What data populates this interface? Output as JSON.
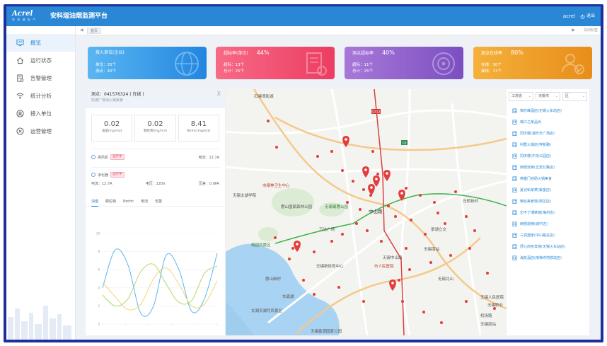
{
  "header": {
    "logo_text": "Acrel",
    "logo_sub": "安 科 瑞 电 气",
    "title": "安科瑞油烟监测平台",
    "user": "acrel",
    "logout": "退出"
  },
  "sidebar": {
    "items": [
      {
        "label": "概览",
        "icon": "overview-icon"
      },
      {
        "label": "运行状态",
        "icon": "home-icon"
      },
      {
        "label": "告警管理",
        "icon": "alarm-doc-icon"
      },
      {
        "label": "统计分析",
        "icon": "wifi-stats-icon"
      },
      {
        "label": "接入单位",
        "icon": "user-icon"
      },
      {
        "label": "运营管理",
        "icon": "gear-circle-icon"
      }
    ]
  },
  "tabs": {
    "home": "首页",
    "close_text": "关闭标签"
  },
  "cards": [
    {
      "title": "接入单位(企业)",
      "pct": "",
      "l1": "单位：25个",
      "l2": "测点：40个"
    },
    {
      "title": "超标率(单位)",
      "pct": "44%",
      "l1": "超标：13个",
      "l2": "总计：25个"
    },
    {
      "title": "测点超标率",
      "pct": "40%",
      "l1": "超标：11个",
      "l2": "总计：25个"
    },
    {
      "title": "测点在线率",
      "pct": "80%",
      "l1": "在线：30个",
      "l2": "离线：11个"
    }
  ],
  "point_panel": {
    "line1": "测点：041576324 ( 在线 )",
    "line2": "凯德广场油火锅美食",
    "close": "X",
    "metrics": [
      {
        "value": "0.02",
        "label": "油烟(mg/m3)"
      },
      {
        "value": "0.02",
        "label": "颗粒物(mg/m3)"
      },
      {
        "value": "8.41",
        "label": "NmHc(mg/m3)"
      }
    ],
    "fan": {
      "label": "排风机",
      "badge": "运行中",
      "current": "电流：12.7A"
    },
    "purifier": {
      "label": "净化器",
      "badge": "运行中"
    },
    "purifier_vals": {
      "current": "电流：12.7A",
      "voltage": "电压：220V",
      "pressure": "压差：0.0PA"
    },
    "chart_tabs": [
      "油烟",
      "颗粒物",
      "NmHc",
      "电流",
      "告警"
    ]
  },
  "chart_data": {
    "type": "line",
    "yticks": [
      "10",
      "8",
      "6",
      "4",
      "2",
      "0"
    ],
    "xticks": [
      "",
      "",
      "",
      "",
      "",
      ""
    ],
    "series": [
      {
        "color": "#5ab6f2",
        "values": [
          4.0,
          8.2,
          6.5,
          1.2,
          2.0,
          7.6,
          6.0,
          1.4,
          2.8,
          7.8
        ]
      },
      {
        "color": "#b4d86e",
        "values": [
          3.2,
          2.0,
          2.8,
          5.8,
          6.6,
          4.4,
          2.4,
          2.6,
          5.6,
          6.4
        ]
      },
      {
        "color": "#f2d675",
        "values": [
          4.6,
          3.0,
          1.6,
          2.2,
          5.0,
          6.2,
          4.4,
          2.0,
          2.2,
          4.8
        ]
      }
    ]
  },
  "map": {
    "labels": [
      "石塘湾影湖",
      "市精神卫生中心",
      "无锡太湖学院",
      "惠山国家森林公园",
      "无锡锡惠公园",
      "中山路",
      "庄桥新村",
      "万达广场",
      "梅园风景区",
      "无锡新体育中心",
      "惠山新村",
      "市人民医院",
      "东鑫湖",
      "太湖灵湖月风景区",
      "无锡南站",
      "景湖立交",
      "无锡人民医院",
      "G312",
      "G2",
      "无锡鑫源国家公园",
      "无锡中山路",
      "无锡职业",
      "机场路",
      "无锡南站",
      "无锡北山"
    ]
  },
  "filters": {
    "province": "江苏省",
    "city": "无锡市",
    "district": "区"
  },
  "stores": [
    "锦亦峰酒店(无锡火车站店)",
    "瑞江之家品尚",
    "同庆楼(湖光市广场店)",
    "利群火锅店(梓新路)",
    "同庆楼(中央公园店)",
    "西部烧烤(五爱北路店)",
    "英雄门自助火锅美食",
    "夏记私家菜(紫金店)",
    "粮丝美食馆(新区店)",
    "忘不了湘菜馆(梅村店)",
    "西部烧烤(城中店)",
    "三润酒家(中山路总店)",
    "舒心商务宾馆(无锡火车站店)",
    "海友酒店(南禅寺地铁站店)"
  ]
}
